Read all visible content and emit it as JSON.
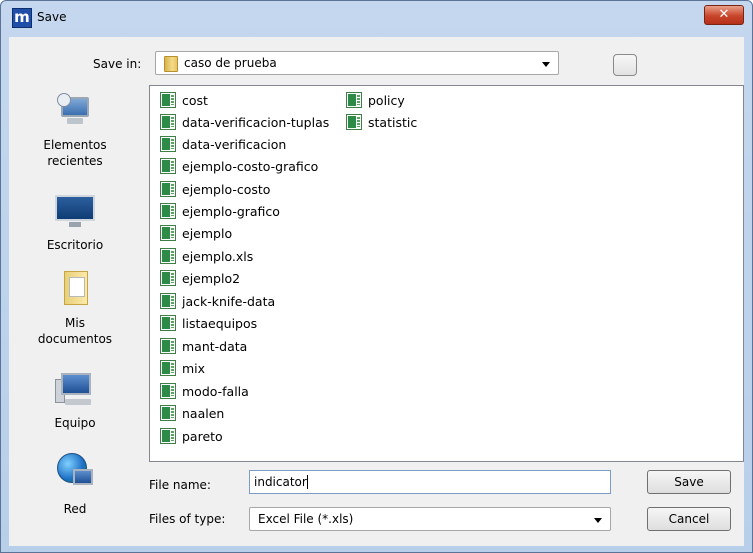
{
  "window": {
    "title": "Save",
    "app_icon_letter": "m",
    "close_glyph": "✕"
  },
  "save_in": {
    "label": "Save in:",
    "value": "caso de prueba"
  },
  "places": [
    {
      "label_line1": "Elementos",
      "label_line2": "recientes",
      "icon": "recent-items-icon"
    },
    {
      "label_line1": "Escritorio",
      "label_line2": "",
      "icon": "desktop-icon"
    },
    {
      "label_line1": "Mis",
      "label_line2": "documentos",
      "icon": "documents-icon"
    },
    {
      "label_line1": "Equipo",
      "label_line2": "",
      "icon": "computer-icon"
    },
    {
      "label_line1": "Red",
      "label_line2": "",
      "icon": "network-icon"
    }
  ],
  "files": {
    "column1": [
      "cost",
      "data-verificacion-tuplas",
      "data-verificacion",
      "ejemplo-costo-grafico",
      "ejemplo-costo",
      "ejemplo-grafico",
      "ejemplo",
      "ejemplo.xls",
      "ejemplo2",
      "jack-knife-data",
      "listaequipos",
      "mant-data",
      "mix",
      "modo-falla",
      "naalen",
      "pareto"
    ],
    "column2": [
      "policy",
      "statistic"
    ]
  },
  "file_name": {
    "label": "File name:",
    "value": "indicator"
  },
  "file_type": {
    "label": "Files of type:",
    "value": "Excel File (*.xls)"
  },
  "buttons": {
    "save": "Save",
    "cancel": "Cancel"
  },
  "colors": {
    "title_bar": "#c4d7ee",
    "close_button": "#c8452a",
    "excel_green": "#2e8b47"
  }
}
